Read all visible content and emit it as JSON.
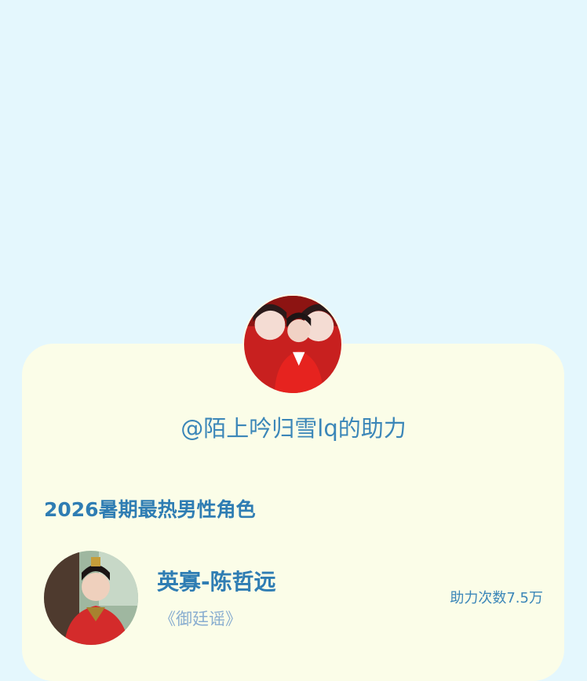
{
  "header": {
    "helper_text": "@陌上吟归雪lq的助力"
  },
  "category": {
    "title": "2026暑期最热男性角色"
  },
  "entry": {
    "character_name": "英寡-陈哲远",
    "drama_title": "《御廷谣》",
    "vote_text": "助力次数7.5万"
  },
  "colors": {
    "page_background": "#e4f7fd",
    "card_background": "#fbfde8",
    "accent_blue": "#2f7db3",
    "muted_blue": "#8aaed0"
  },
  "icons": {
    "main_avatar": "user-avatar-photo",
    "entry_avatar": "character-photo"
  }
}
